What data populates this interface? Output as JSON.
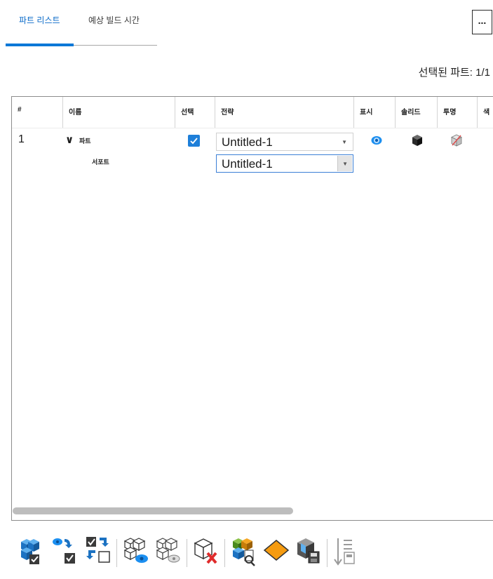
{
  "tabs": [
    {
      "label": "파트 리스트",
      "active": true
    },
    {
      "label": "예상 빌드 시간",
      "active": false
    }
  ],
  "more_button": "...",
  "selected_count": "선택된 파트: 1/1",
  "table": {
    "columns": [
      "#",
      "이름",
      "선택",
      "전략",
      "표시",
      "솔리드",
      "투명",
      "색"
    ],
    "rows": [
      {
        "num": "1",
        "expander": "∨",
        "name": "파트",
        "selected": true,
        "strategy": "Untitled-1",
        "children": [
          {
            "name": "서포트",
            "strategy": "Untitled-1"
          }
        ]
      }
    ]
  },
  "toolbar_icons": [
    "select-all-parts-icon",
    "invert-selection-icon",
    "toggle-selection-icon",
    "show-parts-icon",
    "hide-parts-icon",
    "delete-part-icon",
    "part-properties-icon",
    "slice-plane-icon",
    "save-parts-icon",
    "sort-list-icon"
  ],
  "colors": {
    "accent": "#0a78d7",
    "checkbox": "#1e7fd9",
    "eye": "#1c8ff0",
    "transparent_slash": "#e04848"
  }
}
